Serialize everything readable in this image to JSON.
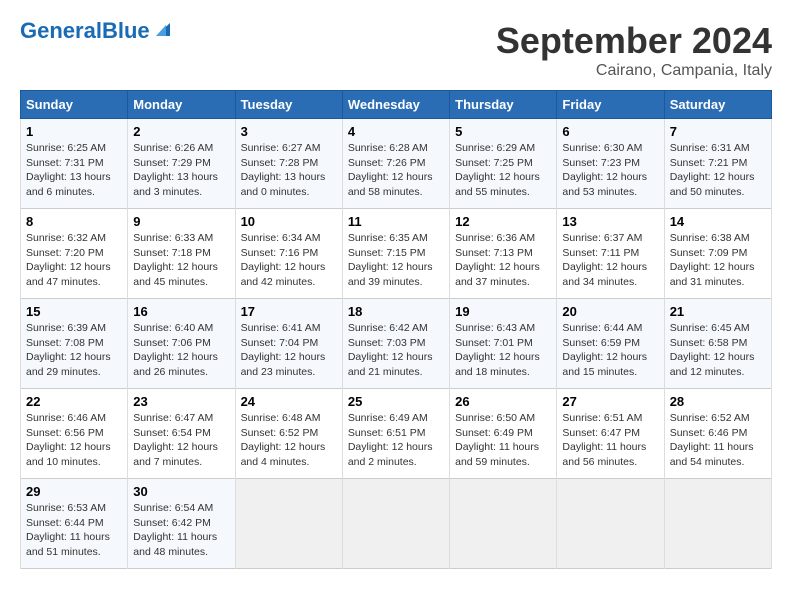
{
  "header": {
    "logo_text1": "General",
    "logo_text2": "Blue",
    "month": "September 2024",
    "location": "Cairano, Campania, Italy"
  },
  "weekdays": [
    "Sunday",
    "Monday",
    "Tuesday",
    "Wednesday",
    "Thursday",
    "Friday",
    "Saturday"
  ],
  "weeks": [
    [
      {
        "day": "1",
        "info": "Sunrise: 6:25 AM\nSunset: 7:31 PM\nDaylight: 13 hours\nand 6 minutes."
      },
      {
        "day": "2",
        "info": "Sunrise: 6:26 AM\nSunset: 7:29 PM\nDaylight: 13 hours\nand 3 minutes."
      },
      {
        "day": "3",
        "info": "Sunrise: 6:27 AM\nSunset: 7:28 PM\nDaylight: 13 hours\nand 0 minutes."
      },
      {
        "day": "4",
        "info": "Sunrise: 6:28 AM\nSunset: 7:26 PM\nDaylight: 12 hours\nand 58 minutes."
      },
      {
        "day": "5",
        "info": "Sunrise: 6:29 AM\nSunset: 7:25 PM\nDaylight: 12 hours\nand 55 minutes."
      },
      {
        "day": "6",
        "info": "Sunrise: 6:30 AM\nSunset: 7:23 PM\nDaylight: 12 hours\nand 53 minutes."
      },
      {
        "day": "7",
        "info": "Sunrise: 6:31 AM\nSunset: 7:21 PM\nDaylight: 12 hours\nand 50 minutes."
      }
    ],
    [
      {
        "day": "8",
        "info": "Sunrise: 6:32 AM\nSunset: 7:20 PM\nDaylight: 12 hours\nand 47 minutes."
      },
      {
        "day": "9",
        "info": "Sunrise: 6:33 AM\nSunset: 7:18 PM\nDaylight: 12 hours\nand 45 minutes."
      },
      {
        "day": "10",
        "info": "Sunrise: 6:34 AM\nSunset: 7:16 PM\nDaylight: 12 hours\nand 42 minutes."
      },
      {
        "day": "11",
        "info": "Sunrise: 6:35 AM\nSunset: 7:15 PM\nDaylight: 12 hours\nand 39 minutes."
      },
      {
        "day": "12",
        "info": "Sunrise: 6:36 AM\nSunset: 7:13 PM\nDaylight: 12 hours\nand 37 minutes."
      },
      {
        "day": "13",
        "info": "Sunrise: 6:37 AM\nSunset: 7:11 PM\nDaylight: 12 hours\nand 34 minutes."
      },
      {
        "day": "14",
        "info": "Sunrise: 6:38 AM\nSunset: 7:09 PM\nDaylight: 12 hours\nand 31 minutes."
      }
    ],
    [
      {
        "day": "15",
        "info": "Sunrise: 6:39 AM\nSunset: 7:08 PM\nDaylight: 12 hours\nand 29 minutes."
      },
      {
        "day": "16",
        "info": "Sunrise: 6:40 AM\nSunset: 7:06 PM\nDaylight: 12 hours\nand 26 minutes."
      },
      {
        "day": "17",
        "info": "Sunrise: 6:41 AM\nSunset: 7:04 PM\nDaylight: 12 hours\nand 23 minutes."
      },
      {
        "day": "18",
        "info": "Sunrise: 6:42 AM\nSunset: 7:03 PM\nDaylight: 12 hours\nand 21 minutes."
      },
      {
        "day": "19",
        "info": "Sunrise: 6:43 AM\nSunset: 7:01 PM\nDaylight: 12 hours\nand 18 minutes."
      },
      {
        "day": "20",
        "info": "Sunrise: 6:44 AM\nSunset: 6:59 PM\nDaylight: 12 hours\nand 15 minutes."
      },
      {
        "day": "21",
        "info": "Sunrise: 6:45 AM\nSunset: 6:58 PM\nDaylight: 12 hours\nand 12 minutes."
      }
    ],
    [
      {
        "day": "22",
        "info": "Sunrise: 6:46 AM\nSunset: 6:56 PM\nDaylight: 12 hours\nand 10 minutes."
      },
      {
        "day": "23",
        "info": "Sunrise: 6:47 AM\nSunset: 6:54 PM\nDaylight: 12 hours\nand 7 minutes."
      },
      {
        "day": "24",
        "info": "Sunrise: 6:48 AM\nSunset: 6:52 PM\nDaylight: 12 hours\nand 4 minutes."
      },
      {
        "day": "25",
        "info": "Sunrise: 6:49 AM\nSunset: 6:51 PM\nDaylight: 12 hours\nand 2 minutes."
      },
      {
        "day": "26",
        "info": "Sunrise: 6:50 AM\nSunset: 6:49 PM\nDaylight: 11 hours\nand 59 minutes."
      },
      {
        "day": "27",
        "info": "Sunrise: 6:51 AM\nSunset: 6:47 PM\nDaylight: 11 hours\nand 56 minutes."
      },
      {
        "day": "28",
        "info": "Sunrise: 6:52 AM\nSunset: 6:46 PM\nDaylight: 11 hours\nand 54 minutes."
      }
    ],
    [
      {
        "day": "29",
        "info": "Sunrise: 6:53 AM\nSunset: 6:44 PM\nDaylight: 11 hours\nand 51 minutes."
      },
      {
        "day": "30",
        "info": "Sunrise: 6:54 AM\nSunset: 6:42 PM\nDaylight: 11 hours\nand 48 minutes."
      },
      null,
      null,
      null,
      null,
      null
    ]
  ]
}
